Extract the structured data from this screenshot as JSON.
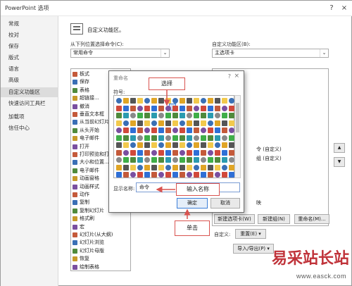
{
  "window": {
    "title": "PowerPoint 选项",
    "help_glyph": "?",
    "close_glyph": "×"
  },
  "nav": {
    "items": [
      {
        "label": "常规"
      },
      {
        "label": "校对"
      },
      {
        "label": "保存"
      },
      {
        "label": "版式"
      },
      {
        "label": "语言"
      },
      {
        "label": "高级"
      },
      {
        "label": "自定义功能区"
      },
      {
        "label": "快速访问工具栏"
      },
      {
        "label": "加载项"
      },
      {
        "label": "信任中心"
      }
    ],
    "active_index": 6
  },
  "header": {
    "text": "自定义功能区。"
  },
  "left_panel": {
    "label": "从下列位置选择命令(C):",
    "combo_value": "常用命令",
    "commands": [
      "板式",
      "保存",
      "表格",
      "超链接...",
      "撤消",
      "垂直文本框",
      "从当前幻灯片",
      "从头开始",
      "电子邮件",
      "打开",
      "打印预览和打印",
      "大小和位置...",
      "电子邮件",
      "动画窗格",
      "动画样式",
      "动作",
      "复制",
      "复制幻灯片",
      "格式刷",
      "宏",
      "幻灯片(从大纲)",
      "幻灯片浏览",
      "幻灯片母版",
      "恢复",
      "绘制表格"
    ]
  },
  "right_panel": {
    "label": "自定义功能区(B):",
    "combo_value": "主选项卡",
    "items": [
      "板",
      "令 (自定义)",
      "组 (自定义)",
      "映"
    ]
  },
  "buttons": {
    "new_tab": "新建选项卡(W)",
    "new_group": "新建组(N)",
    "rename": "重命名(M)...",
    "customize_label": "自定义:",
    "reset": "重置(E) ▾",
    "import_export": "导入/导出(P) ▾",
    "move_up": "▲",
    "move_down": "▼"
  },
  "dialog": {
    "title": "重命名",
    "help_glyph": "?",
    "close_glyph": "×",
    "symbol_label": "符号:",
    "name_label": "显示名称:",
    "name_value": "命令",
    "ok": "确定",
    "cancel": "取消"
  },
  "callouts": {
    "select": "选择",
    "enter_name": "输入名称",
    "click": "单击"
  },
  "watermark": {
    "main": "易采站长站",
    "url": "www.easck.com"
  },
  "colors": {
    "callout_border": "#d9534f",
    "accent_blue": "#3c7fd8",
    "watermark": "#c0333a"
  }
}
